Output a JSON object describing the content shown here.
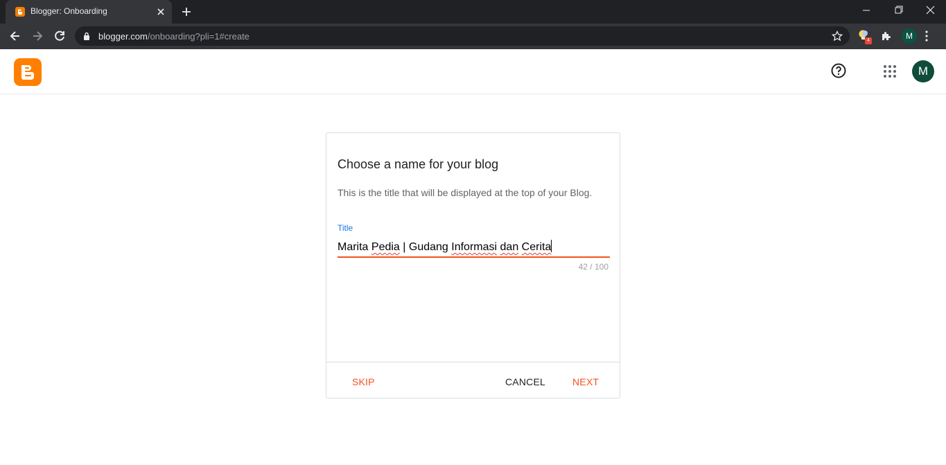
{
  "browser": {
    "tab_title": "Blogger: Onboarding",
    "url_host": "blogger.com",
    "url_path": "/onboarding?pli=1#create",
    "extension_badge": "4",
    "profile_initial": "M"
  },
  "header": {
    "account_initial": "M"
  },
  "dialog": {
    "title": "Choose a name for your blog",
    "description": "This is the title that will be displayed at the top of your Blog.",
    "field_label": "Title",
    "title_value_parts": [
      "Marita ",
      "Pedia",
      " | Gudang ",
      "Informasi",
      " ",
      "dan",
      " ",
      "Cerita"
    ],
    "char_count": "42 / 100",
    "skip_label": "SKIP",
    "cancel_label": "CANCEL",
    "next_label": "NEXT"
  },
  "colors": {
    "accent": "#f4511e",
    "blogger_orange": "#ff8000",
    "label_blue": "#1a73e8"
  }
}
